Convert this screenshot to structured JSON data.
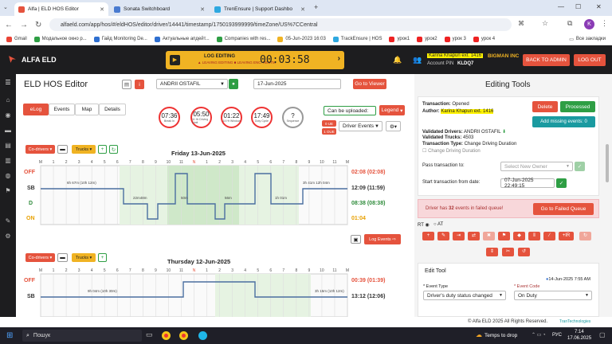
{
  "browser": {
    "tabs": [
      {
        "title": "Alfa | ELD HOS Editor",
        "active": true,
        "favicon_color": "#e5533d"
      },
      {
        "title": "Sonata Switchboard",
        "active": false,
        "favicon_color": "#4a7bd0"
      },
      {
        "title": "TrenEnsure | Support Dashbo",
        "active": false,
        "favicon_color": "#2ea8e0"
      }
    ],
    "url": "alfaeld.com/app/hos/#/eldHOS/editor/driver/14441/timestamp/1750193999999/timeZone/US%7CCentral",
    "profile_letter": "K",
    "bookmarks": [
      "Gmail",
      "Модальное окно р...",
      "Гайд Monitoring De...",
      "Актуальные апдейт...",
      "Companies with res...",
      "05-Jun-2023 16:03",
      "TrackEnsure | HOS",
      "урок1",
      "урок2",
      "урок 3",
      "урок 4"
    ],
    "bookmarks_all": "Все закладки"
  },
  "app": {
    "brand": "ALFA ELD",
    "timer": {
      "label": "LOG EDITING",
      "sub": "▲ LEAVING EDITING  ■ LEAVING ENC. RESTM",
      "time": "00:03:58"
    },
    "account": {
      "name": "Karina Khapun ext. 1416",
      "company": "BIGMAN INC",
      "pin_label": "Account PIN",
      "pin": "KLDQ7"
    },
    "back_to_admin": "BACK TO ADMIN",
    "logout": "LOG OUT"
  },
  "editor": {
    "title": "ELD HOS Editor",
    "driver": "ANDRII OSTAFIL",
    "date": "17-Jun-2025",
    "go_to_viewer": "Go to Viewer",
    "tabs": [
      "eLog",
      "Events",
      "Map",
      "Details"
    ],
    "timers": [
      {
        "value": "07:36",
        "label": "Break In"
      },
      {
        "value": "05:50",
        "label": "11 Hr Driving Limit"
      },
      {
        "value": "01:22",
        "label": "14 Hr Window"
      },
      {
        "value": "17:49",
        "label": "Duty Cycle"
      },
      {
        "value": "?",
        "label": "Sequence"
      }
    ],
    "can_be_uploaded": "Can be uploaded:",
    "legend": "Legend",
    "ue_count1": "0 UE",
    "ue_count2": "1 OUE",
    "driver_events": "Driver Events",
    "co_drivers": "Co-drivers",
    "trucks": "Trucks",
    "log_events_btn": "Log Events",
    "days": [
      {
        "title": "Friday 13-Jun-2025",
        "rows": [
          {
            "code": "OFF",
            "total": "02:08 (02:08)",
            "color": "#e5533d"
          },
          {
            "code": "SB",
            "total": "12:09 (11:59)",
            "color": "#333"
          },
          {
            "code": "D",
            "total": "08:38 (08:38)",
            "color": "#2e8b3a"
          },
          {
            "code": "ON",
            "total": "01:04",
            "color": "#e8a000"
          }
        ],
        "durations": [
          "6h 67m (10h 12m)",
          "22m48m",
          "50m",
          "56m",
          "3h 41m 12h 04m",
          "1h 01m"
        ]
      },
      {
        "title": "Thursday 12-Jun-2025",
        "rows": [
          {
            "code": "OFF",
            "total": "00:39 (01:39)",
            "color": "#e5533d"
          },
          {
            "code": "SB",
            "total": "13:12 (12:06)",
            "color": "#333"
          }
        ],
        "durations": [
          "9h 04m (10h 30m)",
          "3h 15m (10h 12m)"
        ]
      }
    ],
    "hours": [
      "M",
      "1",
      "2",
      "3",
      "4",
      "5",
      "6",
      "7",
      "8",
      "9",
      "10",
      "11",
      "N",
      "1",
      "2",
      "3",
      "4",
      "5",
      "6",
      "7",
      "8",
      "9",
      "10",
      "11",
      "M"
    ]
  },
  "tools": {
    "title": "Editing Tools",
    "transaction_label": "Transaction:",
    "transaction_value": "Opened",
    "author_label": "Author:",
    "author_value": "Karina Khapun ext. 1416",
    "delete": "Delete",
    "processed": "Processed",
    "add_missing": "Add missing events: 0",
    "validated_drivers_label": "Validated Drivers:",
    "validated_drivers_value": "ANDRII OSTAFIL",
    "validated_trucks_label": "Validated Trucks:",
    "validated_trucks_value": "4503",
    "transaction_type_label": "Transaction Type:",
    "transaction_type_value": "Change Driving Duration",
    "change_driving_duration": "Change Driving Duration",
    "pass_label": "Pass transaction to:",
    "pass_placeholder": "Select New Owner",
    "start_label": "Start transaction from date:",
    "start_value": "07-Jun-2025 22:49:15",
    "failed_msg_pre": "Driver has",
    "failed_count": "32",
    "failed_msg_post": "events in failed queue!",
    "go_failed": "Go to Failed Queue",
    "rt": "RT",
    "at": "AT",
    "edit_tool": "Edit Tool",
    "edit_date": "14-Jun-2025 7:55 AM",
    "event_type_label": "* Event Type",
    "event_type_value": "Driver's duty status changed",
    "event_code_label": "* Event Code",
    "event_code_value": "On Duty"
  },
  "footer": {
    "copyright": "© Alfa ELD  2025 All Rights Reserved.",
    "brand": "TranTechnologies"
  },
  "taskbar": {
    "search": "Пошук",
    "weather": "Temps to drop",
    "lang": "РУС",
    "time": "7:14",
    "date": "17.06.2025"
  },
  "colors": {
    "accent": "#e5533d",
    "green": "#2e9e44",
    "teal": "#1a9aa0",
    "gold": "#f0b323",
    "dark": "#1d1d1f"
  }
}
